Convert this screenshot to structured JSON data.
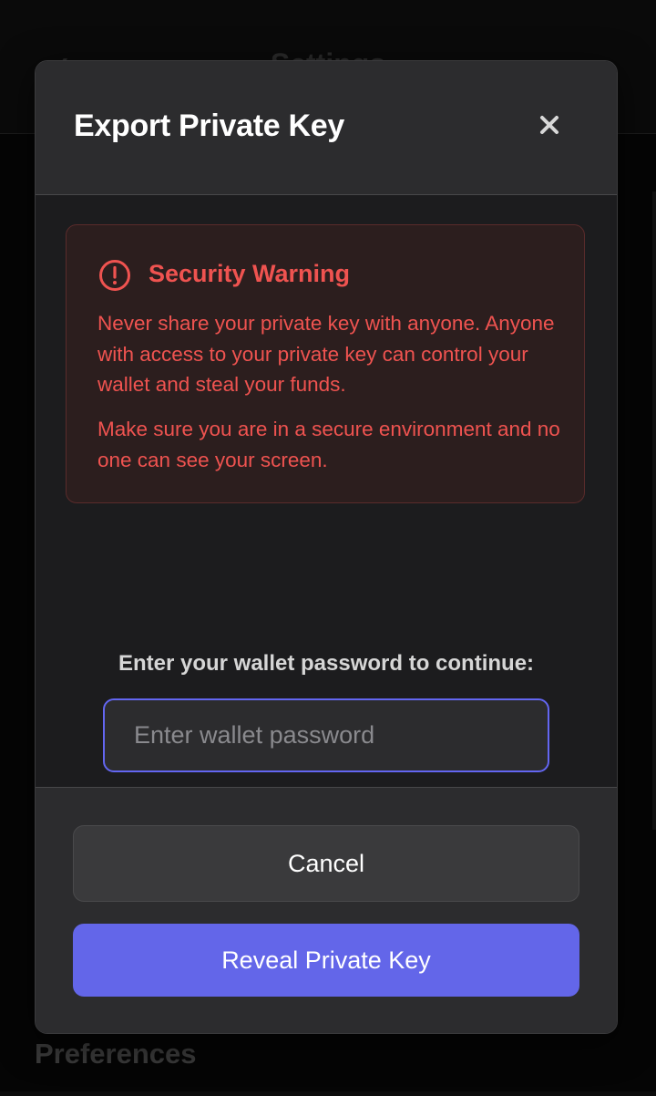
{
  "background": {
    "title": "Settings",
    "section_heading": "Preferences"
  },
  "modal": {
    "title": "Export Private Key",
    "close_icon": "close-icon",
    "warning": {
      "icon": "alert-circle-icon",
      "title": "Security Warning",
      "paragraph_1": "Never share your private key with anyone. Anyone with access to your private key can control your wallet and steal your funds.",
      "paragraph_2": "Make sure you are in a secure environment and no one can see your screen."
    },
    "password": {
      "label": "Enter your wallet password to continue:",
      "placeholder": "Enter wallet password",
      "value": ""
    },
    "buttons": {
      "cancel": "Cancel",
      "reveal": "Reveal Private Key"
    }
  },
  "colors": {
    "accent": "#6366f1",
    "warning": "#ef5350",
    "modal_bg": "#1c1c1e",
    "header_bg": "#2c2c2e"
  }
}
